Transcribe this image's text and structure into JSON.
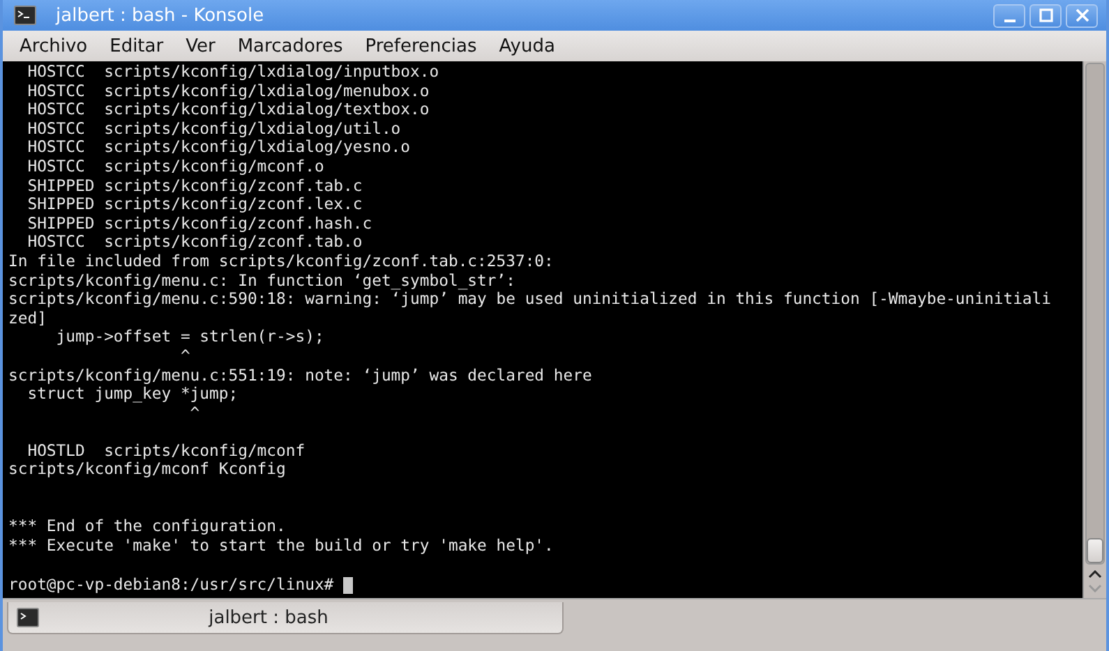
{
  "window": {
    "title": "jalbert : bash - Konsole"
  },
  "menu": [
    "Archivo",
    "Editar",
    "Ver",
    "Marcadores",
    "Preferencias",
    "Ayuda"
  ],
  "terminal": {
    "lines": [
      {
        "kind": "output",
        "text": "  HOSTCC  scripts/kconfig/lxdialog/inputbox.o"
      },
      {
        "kind": "output",
        "text": "  HOSTCC  scripts/kconfig/lxdialog/menubox.o"
      },
      {
        "kind": "output",
        "text": "  HOSTCC  scripts/kconfig/lxdialog/textbox.o"
      },
      {
        "kind": "output",
        "text": "  HOSTCC  scripts/kconfig/lxdialog/util.o"
      },
      {
        "kind": "output",
        "text": "  HOSTCC  scripts/kconfig/lxdialog/yesno.o"
      },
      {
        "kind": "output",
        "text": "  HOSTCC  scripts/kconfig/mconf.o"
      },
      {
        "kind": "output",
        "text": "  SHIPPED scripts/kconfig/zconf.tab.c"
      },
      {
        "kind": "output",
        "text": "  SHIPPED scripts/kconfig/zconf.lex.c"
      },
      {
        "kind": "output",
        "text": "  SHIPPED scripts/kconfig/zconf.hash.c"
      },
      {
        "kind": "output",
        "text": "  HOSTCC  scripts/kconfig/zconf.tab.o"
      },
      {
        "kind": "output",
        "text": "In file included from scripts/kconfig/zconf.tab.c:2537:0:"
      },
      {
        "kind": "output",
        "text": "scripts/kconfig/menu.c: In function ‘get_symbol_str’:"
      },
      {
        "kind": "output",
        "text": "scripts/kconfig/menu.c:590:18: warning: ‘jump’ may be used uninitialized in this function [-Wmaybe-uninitiali"
      },
      {
        "kind": "output",
        "text": "zed]"
      },
      {
        "kind": "output",
        "text": "     jump->offset = strlen(r->s);"
      },
      {
        "kind": "output",
        "text": "                  ^"
      },
      {
        "kind": "output",
        "text": "scripts/kconfig/menu.c:551:19: note: ‘jump’ was declared here"
      },
      {
        "kind": "output",
        "text": "  struct jump_key *jump;"
      },
      {
        "kind": "output",
        "text": "                   ^"
      },
      {
        "kind": "blank"
      },
      {
        "kind": "output",
        "text": "  HOSTLD  scripts/kconfig/mconf"
      },
      {
        "kind": "output",
        "text": "scripts/kconfig/mconf Kconfig"
      },
      {
        "kind": "blank"
      },
      {
        "kind": "blank"
      },
      {
        "kind": "output",
        "text": "*** End of the configuration."
      },
      {
        "kind": "output",
        "text": "*** Execute 'make' to start the build or try 'make help'."
      },
      {
        "kind": "blank"
      },
      {
        "kind": "prompt",
        "text": "root@pc-vp-debian8:/usr/src/linux#",
        "cursor": true
      }
    ]
  },
  "tabs": [
    {
      "label": "jalbert : bash",
      "selected": true
    }
  ]
}
